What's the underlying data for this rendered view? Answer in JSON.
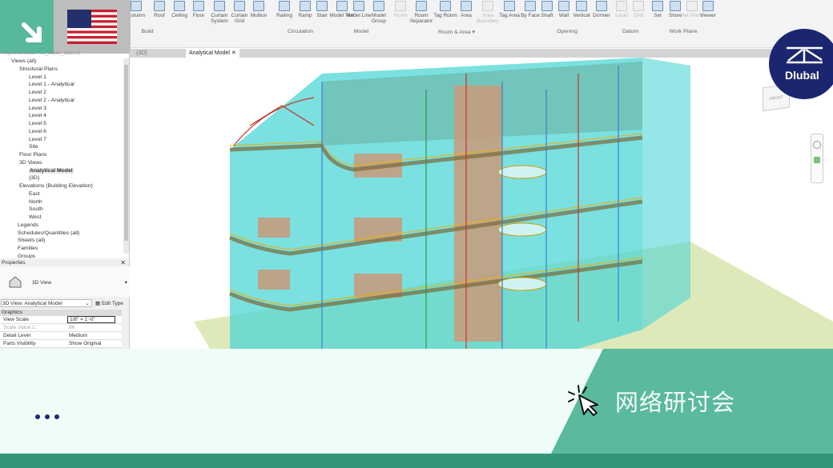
{
  "ribbon": {
    "tools": [
      {
        "label": "Column",
        "dim": false
      },
      {
        "label": "Roof",
        "dim": false
      },
      {
        "label": "Ceiling",
        "dim": false
      },
      {
        "label": "Floor",
        "dim": false
      },
      {
        "label": "Curtain System",
        "dim": false
      },
      {
        "label": "Curtain Grid",
        "dim": false
      },
      {
        "label": "Mullion",
        "dim": false
      },
      {
        "label": "Railing",
        "dim": false
      },
      {
        "label": "Ramp",
        "dim": false
      },
      {
        "label": "Stair",
        "dim": false
      },
      {
        "label": "Model Text",
        "dim": false
      },
      {
        "label": "Model Line",
        "dim": false
      },
      {
        "label": "Model Group",
        "dim": false
      },
      {
        "label": "Room",
        "dim": true
      },
      {
        "label": "Room Separator",
        "dim": false
      },
      {
        "label": "Tag Room",
        "dim": false
      },
      {
        "label": "Area",
        "dim": false
      },
      {
        "label": "Area Boundary",
        "dim": true
      },
      {
        "label": "Tag Area",
        "dim": false
      },
      {
        "label": "By Face",
        "dim": false
      },
      {
        "label": "Shaft",
        "dim": false
      },
      {
        "label": "Wall",
        "dim": false
      },
      {
        "label": "Vertical",
        "dim": false
      },
      {
        "label": "Dormer",
        "dim": false
      },
      {
        "label": "Level",
        "dim": true
      },
      {
        "label": "Grid",
        "dim": true
      },
      {
        "label": "Set",
        "dim": false
      },
      {
        "label": "Show",
        "dim": false
      },
      {
        "label": "Ref Plane",
        "dim": true
      },
      {
        "label": "Viewer",
        "dim": false
      }
    ],
    "groups": [
      "Build",
      "Circulation",
      "Model",
      "Room & Area ▾",
      "Opening",
      "Datum",
      "Work Plane"
    ]
  },
  "tabs": [
    {
      "label": "{3D}"
    },
    {
      "label": "Analytical Model",
      "close": "✕"
    }
  ],
  "browser": {
    "title": "Project Browser - 03_Model_Start.rvt",
    "items": [
      "Views (all)",
      "Structural Plans",
      "Level 1",
      "Level 1 - Analytical",
      "Level 2",
      "Level 2 - Analytical",
      "Level 3",
      "Level 4",
      "Level 5",
      "Level 6",
      "Level 7",
      "Site",
      "Floor Plans",
      "3D Views",
      "Analytical Model",
      "{3D}",
      "Elevations (Building Elevation)",
      "East",
      "North",
      "South",
      "West",
      "Legends",
      "Schedules/Quantities (all)",
      "Sheets (all)",
      "Families",
      "Groups"
    ]
  },
  "properties": {
    "title": "Properties",
    "type": "3D View",
    "selector": "3D View: Analytical Model",
    "edit_type": "Edit Type",
    "section": "Graphics",
    "rows": [
      {
        "k": "View Scale",
        "v": "1/8\" = 1'-0\""
      },
      {
        "k": "Scale Value    1:",
        "v": "96"
      },
      {
        "k": "Detail Level",
        "v": "Medium"
      },
      {
        "k": "Parts Visibility",
        "v": "Show Original"
      }
    ]
  },
  "viewcube": {
    "face": "FRONT"
  },
  "banner": {
    "text": "网络研讨会",
    "colors": {
      "green": "#5bb99d",
      "dark": "#339678",
      "light": "#effcf8",
      "navy": "#1c2670"
    }
  },
  "logo": {
    "text": "Dlubal"
  }
}
